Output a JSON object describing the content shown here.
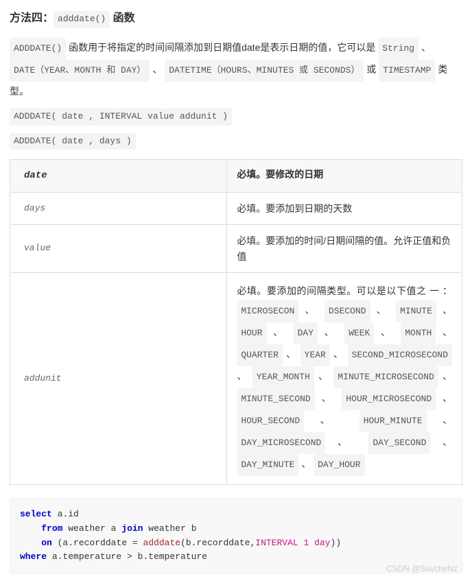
{
  "title_prefix": "方法四：",
  "title_code": "adddate()",
  "title_suffix": " 函数",
  "desc_pre": " 函数用于将指定的时间间隔添加到日期值date是表示日期的值，它可以是 ",
  "desc_c1": "ADDDATE()",
  "desc_c2": "String",
  "desc_sep1": " 、 ",
  "desc_c3": "DATE（YEAR、MONTH 和 DAY）",
  "desc_sep2": " 、 ",
  "desc_c4": "DATETIME（HOURS、MINUTES 或 SECONDS）",
  "desc_sep3": " 或 ",
  "desc_c5": "TIMESTAMP",
  "desc_post": " 类型。",
  "syntax1": "ADDDATE( date , INTERVAL value addunit )",
  "syntax2": "ADDDATE( date , days )",
  "table": {
    "hdr_param": "date",
    "hdr_desc": "必填。要修改的日期",
    "r1_param": "days",
    "r1_desc": "必填。要添加到日期的天数",
    "r2_param": "value",
    "r2_desc": "必填。要添加的时间/日期间隔的值。允许正值和负值",
    "r3_param": "addunit",
    "r3_desc_pre": "必填。要添加的间隔类型。可以是以下值之 一 ：",
    "units": [
      "MICROSECON",
      "DSECOND",
      "MINUTE",
      "HOUR",
      "DAY",
      "WEEK",
      "MONTH",
      "QUARTER",
      "YEAR",
      "SECOND_MICROSECOND",
      "YEAR_MONTH",
      "MINUTE_MICROSECOND",
      "MINUTE_SECOND",
      "HOUR_MICROSECOND",
      "HOUR_SECOND",
      "HOUR_MINUTE",
      "DAY_MICROSECOND",
      "DAY_SECOND",
      "DAY_MINUTE",
      "DAY_HOUR"
    ]
  },
  "code": {
    "kw_select": "select",
    "sel_cols": " a.id",
    "kw_from": "from",
    "from_tbl": " weather a ",
    "kw_join": "join",
    "join_tbl": " weather b",
    "kw_on": "on",
    "on_open": " (a.recorddate = ",
    "fn_adddate": "adddate",
    "on_args_open": "(b.recorddate,",
    "kw_interval": "INTERVAL",
    "sp": " ",
    "num1": "1",
    "kw_day": "day",
    "on_close": "))",
    "kw_where": "where",
    "where_body": " a.temperature > b.temperature"
  },
  "watermark": "CSDN @SavcheNz"
}
